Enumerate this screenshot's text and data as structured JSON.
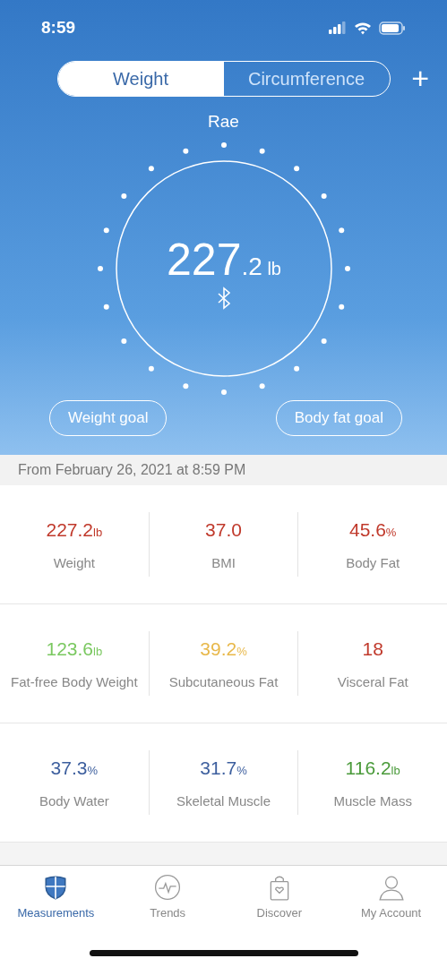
{
  "status_bar": {
    "time": "8:59"
  },
  "segments": [
    {
      "label": "Weight",
      "selected": true
    },
    {
      "label": "Circumference",
      "selected": false
    }
  ],
  "add_button": "+",
  "user_name": "Rae",
  "reading": {
    "whole": "227",
    "decimal": ".2",
    "unit": "lb"
  },
  "goal_buttons": [
    "Weight goal",
    "Body fat goal"
  ],
  "date_line": "From February 26, 2021 at 8:59 PM",
  "metric_rows": [
    [
      {
        "value": "227.2",
        "unit": "lb",
        "label": "Weight",
        "color": "#c0392b"
      },
      {
        "value": "37.0",
        "label": "BMI",
        "color": "#c0392b"
      },
      {
        "value": "45.6",
        "unit": "%",
        "label": "Body Fat",
        "color": "#c0392b"
      }
    ],
    [
      {
        "value": "123.6",
        "unit": "lb",
        "label": "Fat-free Body Weight",
        "color": "#7ac860"
      },
      {
        "value": "39.2",
        "unit": "%",
        "label": "Subcutaneous Fat",
        "color": "#e8b84a"
      },
      {
        "value": "18",
        "label": "Visceral Fat",
        "color": "#c0392b"
      }
    ],
    [
      {
        "value": "37.3",
        "unit": "%",
        "label": "Body Water",
        "color": "#3d5f9e"
      },
      {
        "value": "31.7",
        "unit": "%",
        "label": "Skeletal Muscle",
        "color": "#3d5f9e"
      },
      {
        "value": "116.2",
        "unit": "lb",
        "label": "Muscle Mass",
        "color": "#4a9a3a"
      }
    ]
  ],
  "tab_bar": [
    {
      "label": "Measurements",
      "kind": "shield",
      "selected": true
    },
    {
      "label": "Trends",
      "kind": "pulse",
      "selected": false
    },
    {
      "label": "Discover",
      "kind": "bag",
      "selected": false
    },
    {
      "label": "My Account",
      "kind": "person",
      "selected": false
    }
  ]
}
